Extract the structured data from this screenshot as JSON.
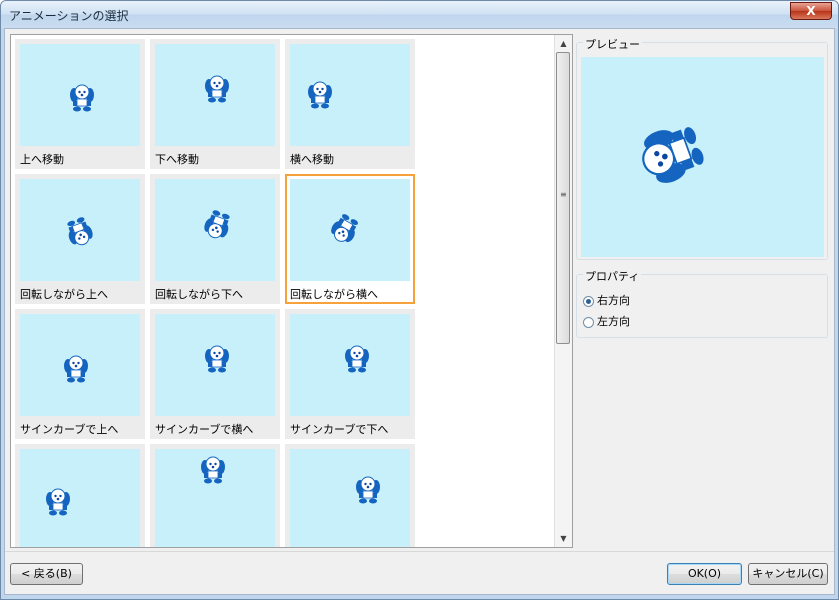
{
  "window": {
    "title": "アニメーションの選択",
    "close_label": "X"
  },
  "gallery": {
    "items": [
      {
        "label": "上へ移動"
      },
      {
        "label": "下へ移動"
      },
      {
        "label": "横へ移動"
      },
      {
        "label": "回転しながら上へ"
      },
      {
        "label": "回転しながら下へ"
      },
      {
        "label": "回転しながら横へ",
        "selected": true
      },
      {
        "label": "サインカーブで上へ"
      },
      {
        "label": "サインカーブで横へ"
      },
      {
        "label": "サインカーブで下へ"
      },
      {
        "label": ""
      },
      {
        "label": ""
      },
      {
        "label": ""
      }
    ]
  },
  "preview": {
    "label": "プレビュー"
  },
  "properties": {
    "label": "プロパティ",
    "options": [
      {
        "label": "右方向",
        "checked": true
      },
      {
        "label": "左方向",
        "checked": false
      }
    ]
  },
  "buttons": {
    "back": "< 戻る(B)",
    "ok": "OK(O)",
    "cancel": "キャンセル(C)"
  },
  "colors": {
    "thumb_bg": "#c8f0fb",
    "selection": "#f6a23a",
    "dog_blue": "#1565c0"
  }
}
